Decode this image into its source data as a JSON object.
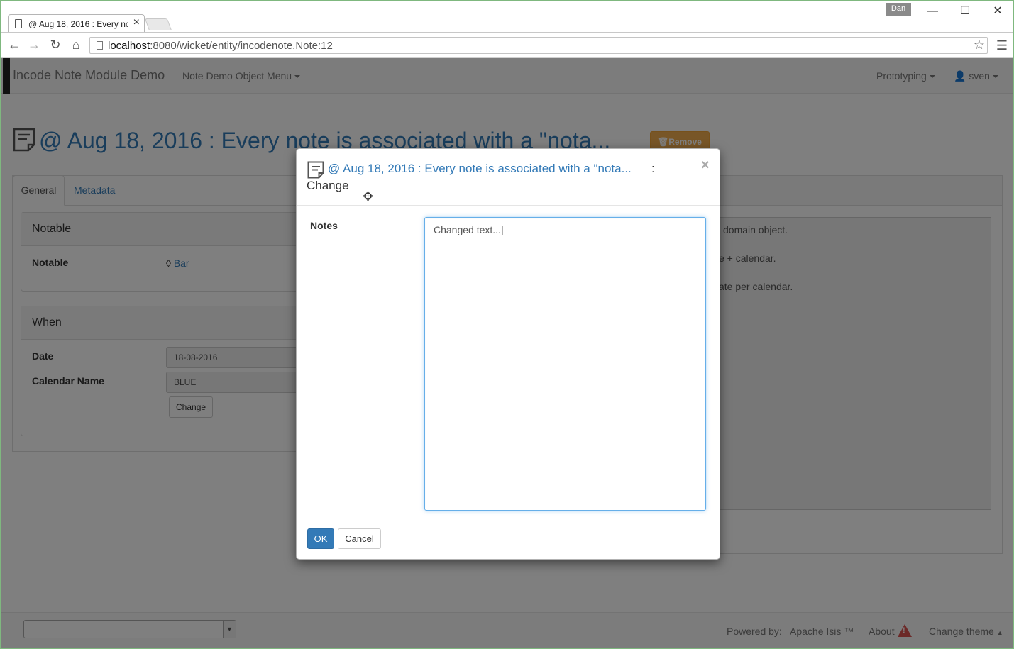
{
  "browser": {
    "tab_title": "@ Aug 18, 2016 : Every nc",
    "tab_close": "×",
    "user_badge": "Dan",
    "minimize": "—",
    "maximize": "☐",
    "close": "✕",
    "url_host": "localhost",
    "url_rest": ":8080/wicket/entity/incodenote.Note:12"
  },
  "navbar": {
    "brand": "Incode Note Module Demo",
    "menu": "Note Demo Object Menu",
    "prototyping": "Prototyping",
    "user": "sven"
  },
  "page": {
    "title": "@ Aug 18, 2016 : Every note is associated with a \"nota...",
    "remove_label": "Remove",
    "tabs": [
      "General",
      "Metadata"
    ],
    "notable_panel": {
      "heading": "Notable",
      "field_label": "Notable",
      "field_value": "Bar"
    },
    "when_panel": {
      "heading": "When",
      "date_label": "Date",
      "date_value": "18-08-2016",
      "calendar_label": "Calendar Name",
      "calendar_value": "BLUE",
      "change_label": "Change"
    },
    "notes_lines": [
      "domain object.",
      "e + calendar.",
      "ate per calendar."
    ]
  },
  "modal": {
    "title_link": "@ Aug 18, 2016 : Every note is associated with a \"nota...",
    "title_colon": ":",
    "title_action": "Change",
    "close": "×",
    "notes_label": "Notes",
    "notes_value": "Changed text...",
    "ok_label": "OK",
    "cancel_label": "Cancel"
  },
  "footer": {
    "powered_by": "Powered by:",
    "apache_isis": "Apache Isis ™",
    "about": "About",
    "change_theme": "Change theme"
  },
  "colors": {
    "link": "#337ab7",
    "warning": "#f0ad4e",
    "primary": "#337ab7",
    "danger": "#d9534f"
  }
}
